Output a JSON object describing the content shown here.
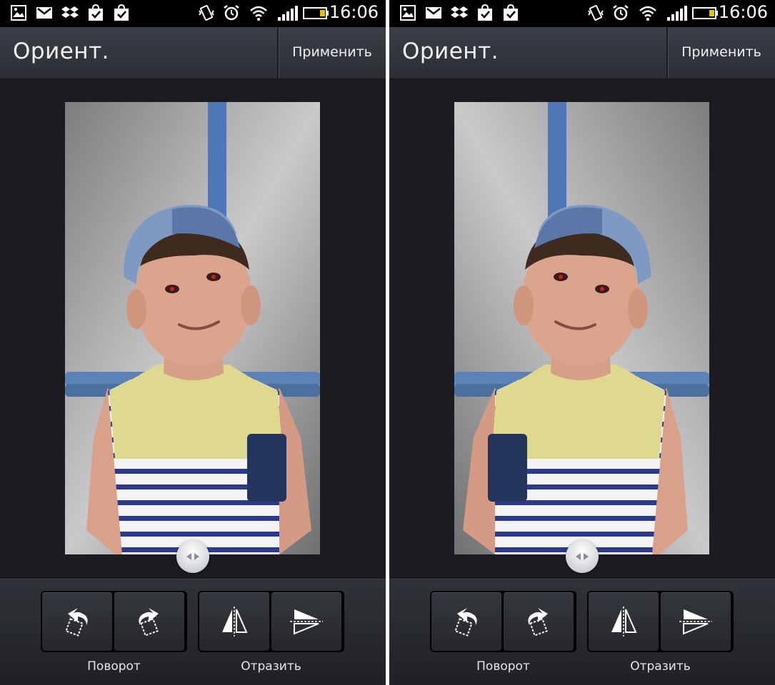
{
  "status_bar": {
    "time": "16:06",
    "left_icons": [
      "gallery-icon",
      "gmail-icon",
      "dropbox-icon",
      "play-store-check-icon",
      "play-store-check-icon"
    ],
    "right_icons": [
      "vibrate-icon",
      "alarm-icon",
      "wifi-icon",
      "signal-icon",
      "battery-icon"
    ]
  },
  "panels": [
    {
      "action_bar": {
        "title": "Ориент.",
        "apply_label": "Применить"
      },
      "photo": {
        "mirrored": false
      },
      "tools": {
        "rotate_label": "Поворот",
        "flip_label": "Отразить"
      }
    },
    {
      "action_bar": {
        "title": "Ориент.",
        "apply_label": "Применить"
      },
      "photo": {
        "mirrored": true
      },
      "tools": {
        "rotate_label": "Поворот",
        "flip_label": "Отразить"
      }
    }
  ],
  "colors": {
    "background": "#1c1c20",
    "action_bar": "#33363d",
    "status_bar": "#000000",
    "battery_level": "#e8c000"
  }
}
